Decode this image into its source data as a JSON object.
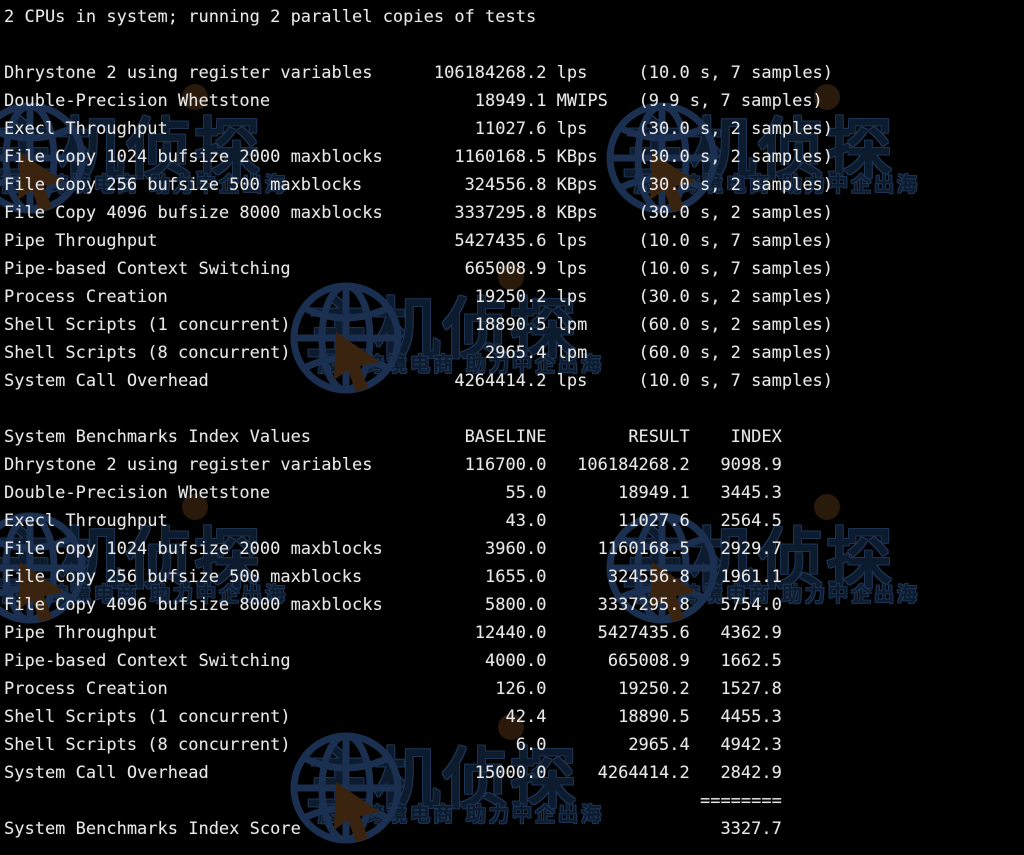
{
  "terminal": {
    "header_line": "2 CPUs in system; running 2 parallel copies of tests",
    "colors": {
      "background": "#000000",
      "foreground": "#e8e8e8",
      "watermark": "#14253d",
      "watermark_accent": "#2a1a0c"
    }
  },
  "watermark": {
    "brand_title": "主机侦探",
    "brand_subtitle": "服务跨境电商 助力中企出海",
    "globe_icon": "globe-icon",
    "cursor_icon": "cursor-arrow-icon"
  },
  "benchmark_run": {
    "columns": [
      "test",
      "value",
      "unit",
      "timing"
    ],
    "rows": [
      {
        "test": "Dhrystone 2 using register variables",
        "value": "106184268.2",
        "unit": "lps",
        "timing": "(10.0 s, 7 samples)"
      },
      {
        "test": "Double-Precision Whetstone",
        "value": "18949.1",
        "unit": "MWIPS",
        "timing": "(9.9 s, 7 samples)"
      },
      {
        "test": "Execl Throughput",
        "value": "11027.6",
        "unit": "lps",
        "timing": "(30.0 s, 2 samples)"
      },
      {
        "test": "File Copy 1024 bufsize 2000 maxblocks",
        "value": "1160168.5",
        "unit": "KBps",
        "timing": "(30.0 s, 2 samples)"
      },
      {
        "test": "File Copy 256 bufsize 500 maxblocks",
        "value": "324556.8",
        "unit": "KBps",
        "timing": "(30.0 s, 2 samples)"
      },
      {
        "test": "File Copy 4096 bufsize 8000 maxblocks",
        "value": "3337295.8",
        "unit": "KBps",
        "timing": "(30.0 s, 2 samples)"
      },
      {
        "test": "Pipe Throughput",
        "value": "5427435.6",
        "unit": "lps",
        "timing": "(10.0 s, 7 samples)"
      },
      {
        "test": "Pipe-based Context Switching",
        "value": "665008.9",
        "unit": "lps",
        "timing": "(10.0 s, 7 samples)"
      },
      {
        "test": "Process Creation",
        "value": "19250.2",
        "unit": "lps",
        "timing": "(30.0 s, 2 samples)"
      },
      {
        "test": "Shell Scripts (1 concurrent)",
        "value": "18890.5",
        "unit": "lpm",
        "timing": "(60.0 s, 2 samples)"
      },
      {
        "test": "Shell Scripts (8 concurrent)",
        "value": "2965.4",
        "unit": "lpm",
        "timing": "(60.0 s, 2 samples)"
      },
      {
        "test": "System Call Overhead",
        "value": "4264414.2",
        "unit": "lps",
        "timing": "(10.0 s, 7 samples)"
      }
    ]
  },
  "index_values": {
    "section_title": "System Benchmarks Index Values",
    "headers": {
      "baseline": "BASELINE",
      "result": "RESULT",
      "index": "INDEX"
    },
    "rows": [
      {
        "test": "Dhrystone 2 using register variables",
        "baseline": "116700.0",
        "result": "106184268.2",
        "index": "9098.9"
      },
      {
        "test": "Double-Precision Whetstone",
        "baseline": "55.0",
        "result": "18949.1",
        "index": "3445.3"
      },
      {
        "test": "Execl Throughput",
        "baseline": "43.0",
        "result": "11027.6",
        "index": "2564.5"
      },
      {
        "test": "File Copy 1024 bufsize 2000 maxblocks",
        "baseline": "3960.0",
        "result": "1160168.5",
        "index": "2929.7"
      },
      {
        "test": "File Copy 256 bufsize 500 maxblocks",
        "baseline": "1655.0",
        "result": "324556.8",
        "index": "1961.1"
      },
      {
        "test": "File Copy 4096 bufsize 8000 maxblocks",
        "baseline": "5800.0",
        "result": "3337295.8",
        "index": "5754.0"
      },
      {
        "test": "Pipe Throughput",
        "baseline": "12440.0",
        "result": "5427435.6",
        "index": "4362.9"
      },
      {
        "test": "Pipe-based Context Switching",
        "baseline": "4000.0",
        "result": "665008.9",
        "index": "1662.5"
      },
      {
        "test": "Process Creation",
        "baseline": "126.0",
        "result": "19250.2",
        "index": "1527.8"
      },
      {
        "test": "Shell Scripts (1 concurrent)",
        "baseline": "42.4",
        "result": "18890.5",
        "index": "4455.3"
      },
      {
        "test": "Shell Scripts (8 concurrent)",
        "baseline": "6.0",
        "result": "2965.4",
        "index": "4942.3"
      },
      {
        "test": "System Call Overhead",
        "baseline": "15000.0",
        "result": "4264414.2",
        "index": "2842.9"
      }
    ],
    "separator": "========",
    "score_label": "System Benchmarks Index Score",
    "score_value": "3327.7"
  }
}
